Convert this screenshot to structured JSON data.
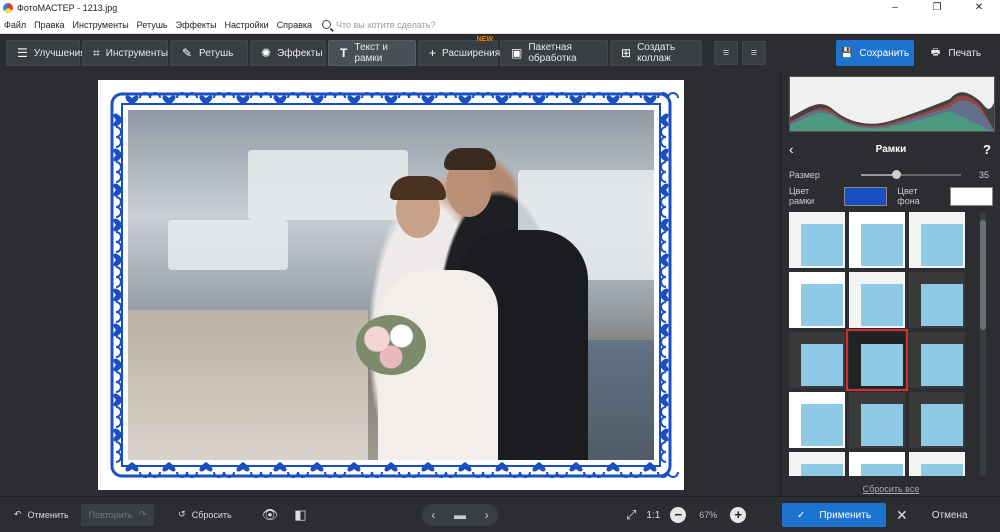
{
  "window": {
    "title": "ФотоМАСТЕР - 1213.jpg",
    "controls": [
      "–",
      "❐",
      "✕"
    ]
  },
  "menu": {
    "items": [
      "Файл",
      "Правка",
      "Инструменты",
      "Ретушь",
      "Эффекты",
      "Настройки",
      "Справка"
    ],
    "search_placeholder": "Что вы хотите сделать?"
  },
  "toolbar": {
    "tabs": [
      {
        "label": "Улучшения",
        "icon": "sliders-icon"
      },
      {
        "label": "Инструменты",
        "icon": "crop-icon"
      },
      {
        "label": "Ретушь",
        "icon": "brush-icon"
      },
      {
        "label": "Эффекты",
        "icon": "sparkle-icon"
      },
      {
        "label": "Текст и рамки",
        "icon": "text-icon",
        "active": true
      },
      {
        "label": "Расширения",
        "icon": "plus-icon",
        "badge": "NEW"
      },
      {
        "label": "Пакетная обработка",
        "icon": "image-stack-icon"
      },
      {
        "label": "Создать коллаж",
        "icon": "collage-icon"
      }
    ],
    "save_label": "Сохранить",
    "print_label": "Печать"
  },
  "panel": {
    "title": "Рамки",
    "size_label": "Размер",
    "size_value": "35",
    "size_fraction": 0.35,
    "frame_color_label": "Цвет рамки",
    "frame_color": "#1a4fc4",
    "bg_color_label": "Цвет фона",
    "bg_color": "#ffffff",
    "reset_all": "Сбросить все",
    "selected_thumb": 7
  },
  "bottom": {
    "undo": "Отменить",
    "redo": "Повторить",
    "reset": "Сбросить",
    "zoom_fit": "1:1",
    "zoom_level": "67%",
    "apply": "Применить",
    "cancel": "Отмена"
  },
  "colors": {
    "accent": "#1d73d0",
    "selection": "#d32f2f",
    "thumb_fill": "#8ecae6"
  }
}
